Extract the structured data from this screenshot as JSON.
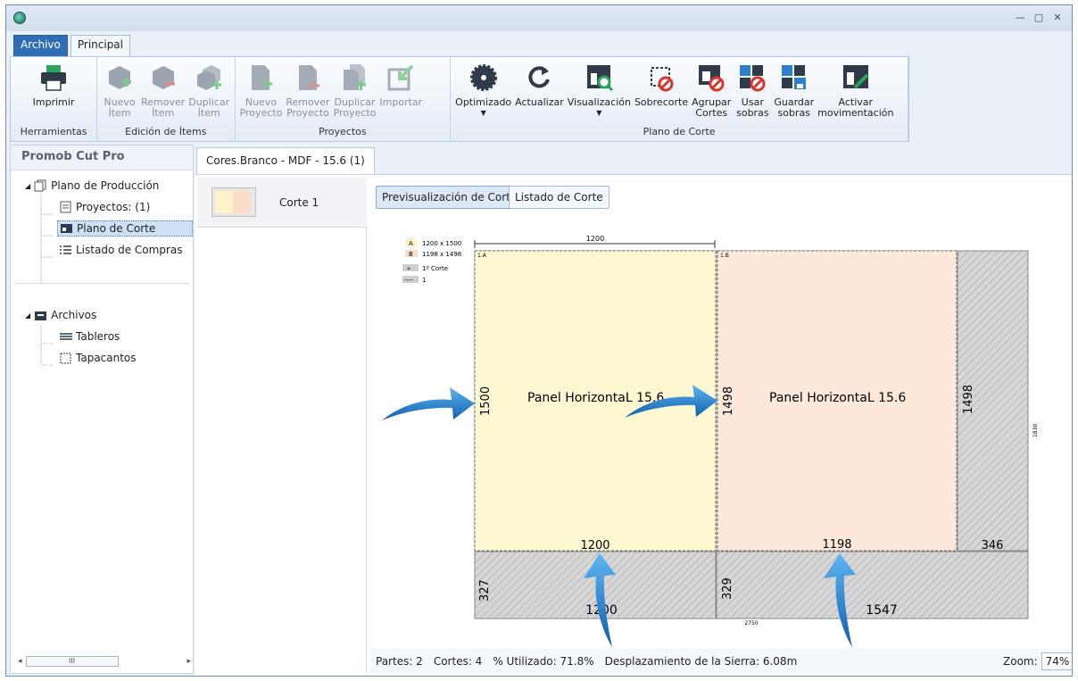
{
  "window": {
    "controls": [
      "—",
      "▢",
      "✕"
    ]
  },
  "menu_tabs": [
    "Archivo",
    "Principal"
  ],
  "ribbon": {
    "groups": [
      {
        "label": "Herramientas",
        "buttons": [
          {
            "label": "Imprimir",
            "icon": "printer-icon"
          }
        ]
      },
      {
        "label": "Edición de Ítems",
        "buttons": [
          {
            "label": "Nuevo\nÍtem",
            "icon": "new-item-icon"
          },
          {
            "label": "Remover\nÍtem",
            "icon": "remove-item-icon"
          },
          {
            "label": "Duplicar\nÍtem",
            "icon": "duplicate-item-icon"
          }
        ]
      },
      {
        "label": "Proyectos",
        "buttons": [
          {
            "label": "Nuevo\nProyecto",
            "icon": "new-project-icon"
          },
          {
            "label": "Remover\nProyecto",
            "icon": "remove-project-icon"
          },
          {
            "label": "Duplicar\nProyecto",
            "icon": "duplicate-project-icon"
          },
          {
            "label": "Importar",
            "icon": "import-icon"
          }
        ]
      },
      {
        "label": "Plano de Corte",
        "buttons": [
          {
            "label": "Optimizado",
            "icon": "saw-blade-icon"
          },
          {
            "label": "Actualizar",
            "icon": "refresh-icon"
          },
          {
            "label": "Visualización",
            "icon": "view-icon"
          },
          {
            "label": "Sobrecorte",
            "icon": "overcut-icon"
          },
          {
            "label": "Agrupar\nCortes",
            "icon": "group-cuts-icon"
          },
          {
            "label": "Usar\nsobras",
            "icon": "use-leftovers-icon"
          },
          {
            "label": "Guardar\nsobras",
            "icon": "save-leftovers-icon"
          },
          {
            "label": "Activar\nmovimentación",
            "icon": "activate-movement-icon"
          }
        ]
      }
    ]
  },
  "sidebar": {
    "title": "Promob Cut Pro",
    "tree": {
      "production_plan": "Plano de Producción",
      "projects": "Proyectos: (1)",
      "cut_plan": "Plano de Corte",
      "shopping_list": "Listado de Compras",
      "files": "Archivos",
      "boards": "Tableros",
      "edge_banding": "Tapacantos"
    }
  },
  "document": {
    "tab": "Cores.Branco - MDF - 15.6 (1)",
    "cut_list": [
      "Corte 1"
    ],
    "view_buttons": {
      "preview": "Previsualización de Corte",
      "list": "Listado de Corte"
    },
    "legend": [
      {
        "key": "A",
        "text": "1200 x 1500"
      },
      {
        "key": "B",
        "text": "1198 x 1498"
      },
      {
        "key": "»",
        "text": "1º Corte"
      },
      {
        "key": "----",
        "text": "1"
      }
    ],
    "drawing": {
      "top_dim": "1200",
      "right_dim": "1830",
      "bottom_dim": "2750",
      "piece_a": {
        "tag": "1.A",
        "name": "Panel HorizontaL 15.6",
        "h": "1500",
        "w": "1200"
      },
      "piece_b": {
        "tag": "1.B",
        "name": "Panel HorizontaL 15.6",
        "h": "1498",
        "w": "1198"
      },
      "waste_right": {
        "h": "1498",
        "w": "346"
      },
      "waste_bottom_left": {
        "h": "327",
        "w": "1200"
      },
      "waste_bottom_right": {
        "h": "329",
        "w": "1547"
      }
    }
  },
  "status": {
    "parts": "Partes: 2",
    "cuts": "Cortes: 4",
    "used": "% Utilizado: 71.8%",
    "saw": "Desplazamiento de la Sierra: 6.08m",
    "zoom_label": "Zoom:",
    "zoom_value": "74%"
  },
  "colors": {
    "piece_a": "#fdf8d2",
    "piece_b": "#fde8da",
    "waste": "#d4d4d4",
    "accent": "#2f6eb5",
    "arrow": "#1e7fd0"
  }
}
